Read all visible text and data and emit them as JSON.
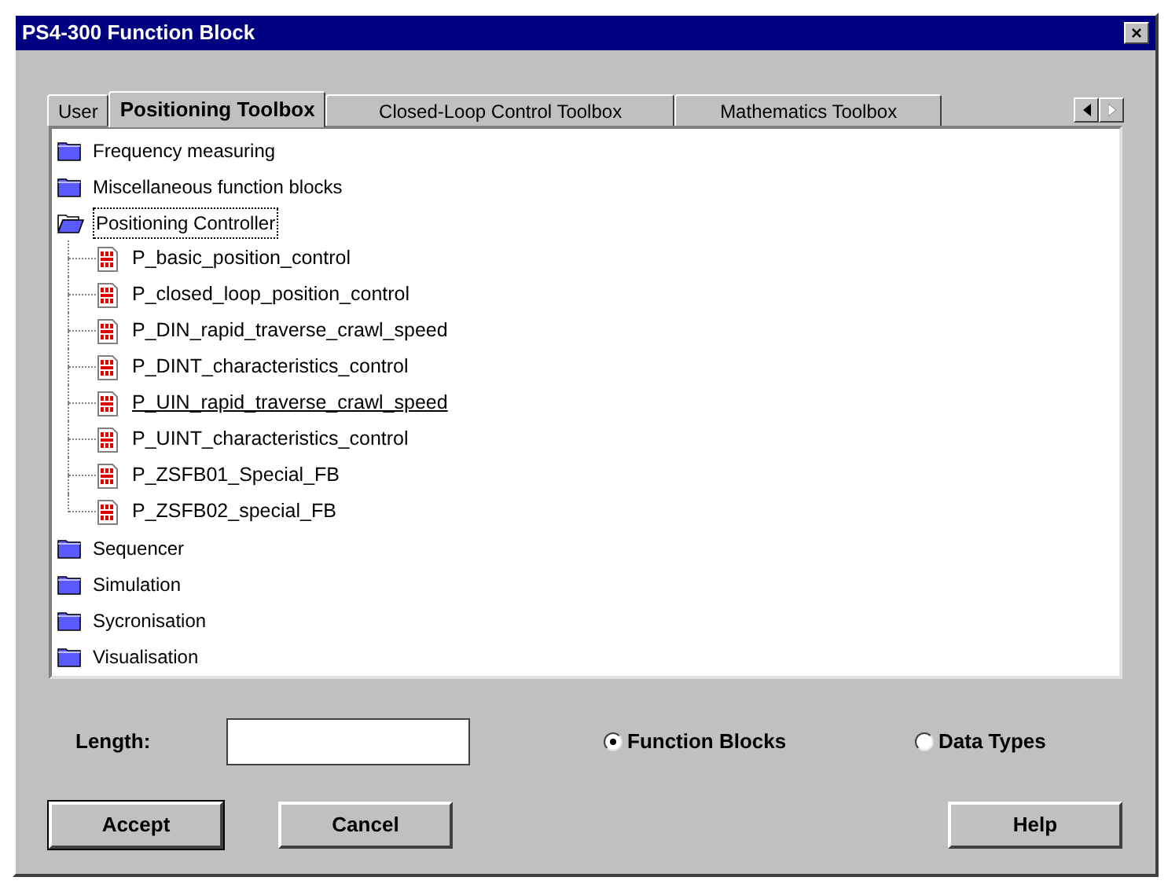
{
  "window": {
    "title": "PS4-300 Function Block",
    "close": "×"
  },
  "tabs": [
    {
      "label": "User",
      "selected": false
    },
    {
      "label": "Positioning Toolbox",
      "selected": true
    },
    {
      "label": "Closed-Loop Control Toolbox",
      "selected": false
    },
    {
      "label": "Mathematics Toolbox",
      "selected": false
    }
  ],
  "tab_scroll": [
    {
      "kind": "left",
      "disabled": false
    },
    {
      "kind": "right",
      "disabled": true
    }
  ],
  "tree": [
    {
      "label": "Frequency measuring",
      "expanded": false,
      "selected": false
    },
    {
      "label": "Miscellaneous function blocks",
      "expanded": false,
      "selected": false
    },
    {
      "label": "Positioning Controller",
      "expanded": true,
      "selected": true,
      "children": [
        {
          "label": "P_basic_position_control",
          "hot": false
        },
        {
          "label": "P_closed_loop_position_control",
          "hot": false
        },
        {
          "label": "P_DIN_rapid_traverse_crawl_speed",
          "hot": false
        },
        {
          "label": "P_DINT_characteristics_control",
          "hot": false
        },
        {
          "label": "P_UIN_rapid_traverse_crawl_speed",
          "hot": true
        },
        {
          "label": "P_UINT_characteristics_control",
          "hot": false
        },
        {
          "label": "P_ZSFB01_Special_FB",
          "hot": false
        },
        {
          "label": "P_ZSFB02_special_FB",
          "hot": false
        }
      ]
    },
    {
      "label": "Sequencer",
      "expanded": false,
      "selected": false
    },
    {
      "label": "Simulation",
      "expanded": false,
      "selected": false
    },
    {
      "label": "Sycronisation",
      "expanded": false,
      "selected": false
    },
    {
      "label": "Visualisation",
      "expanded": false,
      "selected": false
    }
  ],
  "length": {
    "label": "Length:"
  },
  "radios": [
    {
      "label": "Function Blocks",
      "selected": true
    },
    {
      "label": "Data Types",
      "selected": false
    }
  ],
  "buttons": [
    {
      "label": "Accept",
      "default": true
    },
    {
      "label": "Cancel",
      "default": false
    },
    {
      "label": "Help",
      "default": false
    }
  ]
}
